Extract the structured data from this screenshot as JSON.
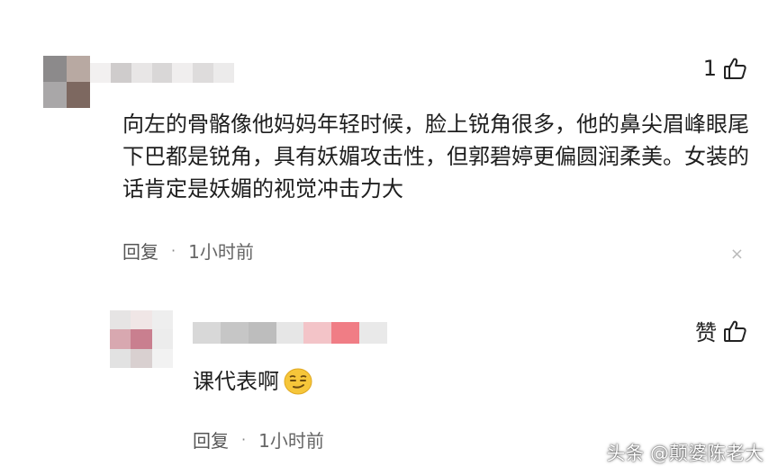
{
  "comments": [
    {
      "like_count": "1",
      "text": "向左的骨骼像他妈妈年轻时候，脸上锐角很多，他的鼻尖眉峰眼尾下巴都是锐角，具有妖媚攻击性，但郭碧婷更偏圆润柔美。女装的话肯定是妖媚的视觉冲击力大",
      "reply_label": "回复",
      "separator": "·",
      "time": "1小时前",
      "close_glyph": "×",
      "avatar_colors": [
        "#8c8a8b",
        "#b8a9a2",
        "#a9a7a8",
        "#7d6860"
      ],
      "name_colors": [
        "#f2f0f0",
        "#cfcccc",
        "#e8e6e6",
        "#d9d7d7",
        "#f0eeee",
        "#dedcdc",
        "#ecebeb"
      ]
    },
    {
      "like_label": "赞",
      "text": "课代表啊",
      "emoji": "smirk-face-emoji",
      "reply_label": "回复",
      "separator": "·",
      "time": "1小时前",
      "avatar_colors": [
        "#e6e4e4",
        "#f0e6e6",
        "#eeeeee",
        "#d8a8b0",
        "#c97f8f",
        "#ececec",
        "#e2e2e2",
        "#d9d0d0",
        "#f2f2f2"
      ],
      "name_colors": [
        "#d8d8d8",
        "#c6c6c6",
        "#bdbdbd",
        "#e6e6e6",
        "#f3c4c8",
        "#f07d85",
        "#e9e9e9"
      ]
    }
  ],
  "watermark": "头条 @颠婆陈老大",
  "icons": {
    "like": "thumbs-up-icon",
    "close": "close-icon"
  }
}
